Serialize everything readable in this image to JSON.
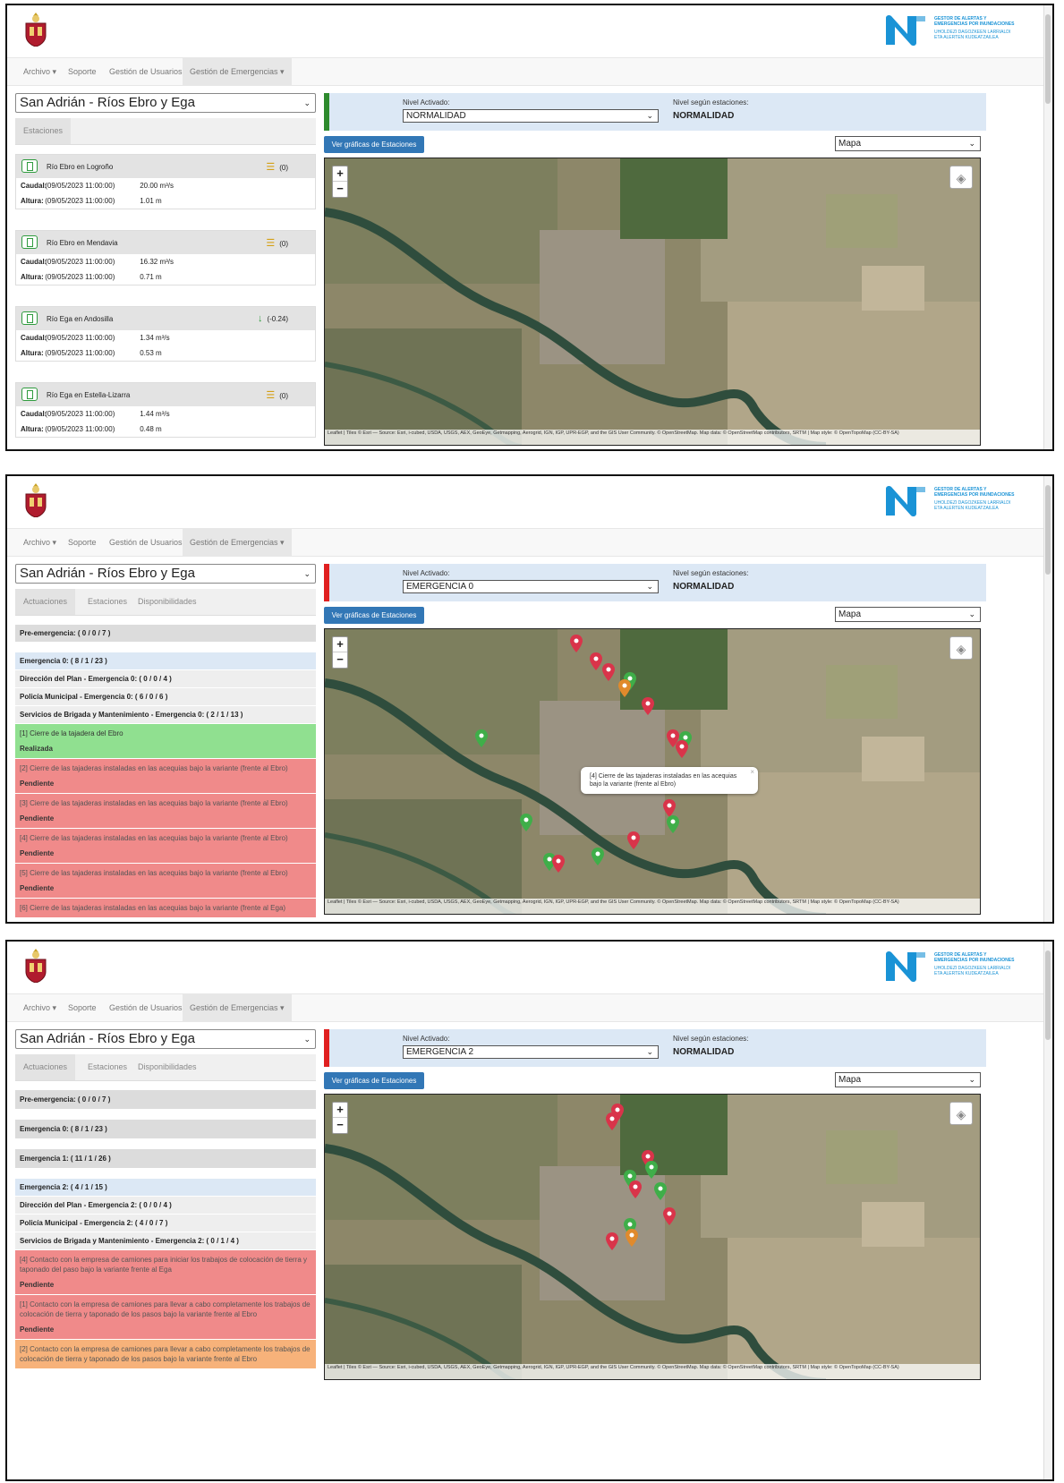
{
  "nav": {
    "archivo": "Archivo ▾",
    "soporte": "Soporte",
    "usuarios": "Gestión de Usuarios",
    "emergencias": "Gestión de Emergencias ▾"
  },
  "logo": {
    "line1": "GESTOR DE ALERTAS Y EMERGENCIAS POR INUNDACIONES",
    "line2": "UHOLDEZI DAGOZKEEN LARRIALDI ETA ALERTEN KUDEATZAILEA"
  },
  "common": {
    "municipio": "San Adrián - Ríos Ebro y Ega",
    "nivel_activado_label": "Nivel Activado:",
    "nivel_estaciones_label": "Nivel según estaciones:",
    "nivel_estaciones_value": "NORMALIDAD",
    "graficas_button": "Ver gráficas de Estaciones",
    "map_mode": "Mapa",
    "attribution": "Leaflet | Tiles © Esri — Source: Esri, i-cubed, USDA, USGS, AEX, GeoEye, Getmapping, Aerogrid, IGN, IGP, UPR-EGP, and the GIS User Community. © OpenStreetMap. Map data: © OpenStreetMap contributors, SRTM | Map style: © OpenTopoMap (CC-BY-SA)",
    "zoom_in": "+",
    "zoom_out": "−"
  },
  "colors": {
    "normal": "#2e8b2e",
    "emergency": "#e02020",
    "pin_red": "#d9344a",
    "pin_green": "#3fae49",
    "pin_orange": "#e08a2c"
  },
  "panel1": {
    "tab_estaciones": "Estaciones",
    "nivel_activado_value": "NORMALIDAD",
    "stations": [
      {
        "name": "Río Ebro en Logroño",
        "trend_icon": "equal-icon",
        "trend": "(0)",
        "caudal_label": "Caudal:",
        "caudal_date": "(09/05/2023 11:00:00)",
        "caudal_value": "20.00 m³/s",
        "altura_label": "Altura:",
        "altura_date": "(09/05/2023 11:00:00)",
        "altura_value": "1.01 m"
      },
      {
        "name": "Río Ebro en Mendavia",
        "trend_icon": "equal-icon",
        "trend": "(0)",
        "caudal_label": "Caudal:",
        "caudal_date": "(09/05/2023 11:00:00)",
        "caudal_value": "16.32 m³/s",
        "altura_label": "Altura:",
        "altura_date": "(09/05/2023 11:00:00)",
        "altura_value": "0.71 m"
      },
      {
        "name": "Río Ega en Andosilla",
        "trend_icon": "arrow-down-icon",
        "trend": "(-0.24)",
        "caudal_label": "Caudal:",
        "caudal_date": "(09/05/2023 11:00:00)",
        "caudal_value": "1.34 m³/s",
        "altura_label": "Altura:",
        "altura_date": "(09/05/2023 11:00:00)",
        "altura_value": "0.53 m"
      },
      {
        "name": "Río Ega en Estella-Lizarra",
        "trend_icon": "equal-icon",
        "trend": "(0)",
        "caudal_label": "Caudal:",
        "caudal_date": "(09/05/2023 11:00:00)",
        "caudal_value": "1.44 m³/s",
        "altura_label": "Altura:",
        "altura_date": "(09/05/2023 11:00:00)",
        "altura_value": "0.48 m"
      }
    ]
  },
  "panel2": {
    "tabs": [
      "Actuaciones",
      "Estaciones",
      "Disponibilidades"
    ],
    "nivel_activado_value": "EMERGENCIA 0",
    "popup": "[4] Cierre de las tajaderas instaladas en las acequias bajo la variante (frente al Ebro)",
    "rows": {
      "pre": "Pre-emergencia: ( 0 / 0 / 7 )",
      "e0": "Emergencia 0: ( 8 / 1 / 23 )",
      "dir": "Dirección del Plan - Emergencia 0: ( 0 / 0 / 4 )",
      "pol": "Policía Municipal - Emergencia 0: ( 6 / 0 / 6 )",
      "serv": "Servicios de Brigada y Mantenimiento - Emergencia 0: ( 2 / 1 / 13 )",
      "a1": "[1] Cierre de la tajadera del Ebro",
      "a1s": "Realizada",
      "a2": "[2] Cierre de las tajaderas instaladas en las acequias bajo la variante (frente al Ebro)",
      "a2s": "Pendiente",
      "a3": "[3] Cierre de las tajaderas instaladas en las acequias bajo la variante (frente al Ebro)",
      "a3s": "Pendiente",
      "a4": "[4] Cierre de las tajaderas instaladas en las acequias bajo la variante (frente al Ebro)",
      "a4s": "Pendiente",
      "a5": "[5] Cierre de las tajaderas instaladas en las acequias bajo la variante (frente al Ebro)",
      "a5s": "Pendiente",
      "a6": "[6] Cierre de las tajaderas instaladas en las acequias bajo la variante (frente al Ega)"
    }
  },
  "panel3": {
    "tabs": [
      "Actuaciones",
      "Estaciones",
      "Disponibilidades"
    ],
    "nivel_activado_value": "EMERGENCIA 2",
    "rows": {
      "pre": "Pre-emergencia: ( 0 / 0 / 7 )",
      "e0": "Emergencia 0: ( 8 / 1 / 23 )",
      "e1": "Emergencia 1: ( 11 / 1 / 26 )",
      "e2": "Emergencia 2: ( 4 / 1 / 15 )",
      "dir": "Dirección del Plan - Emergencia 2: ( 0 / 0 / 4 )",
      "pol": "Policía Municipal - Emergencia 2: ( 4 / 0 / 7 )",
      "serv": "Servicios de Brigada y Mantenimiento - Emergencia 2: ( 0 / 1 / 4 )",
      "b4": "[4] Contacto con la empresa de camiones para iniciar los trabajos de colocación de tierra y taponado del paso bajo la variante frente al Ega",
      "b4s": "Pendiente",
      "b1": "[1] Contacto con la empresa de camiones para llevar a cabo completamente los trabajos de colocación de tierra y taponado de los pasos bajo la variante frente al Ebro",
      "b1s": "Pendiente",
      "b2": "[2] Contacto con la empresa de camiones para llevar a cabo completamente los trabajos de colocación de tierra y taponado de los pasos bajo la variante frente al Ebro"
    }
  }
}
